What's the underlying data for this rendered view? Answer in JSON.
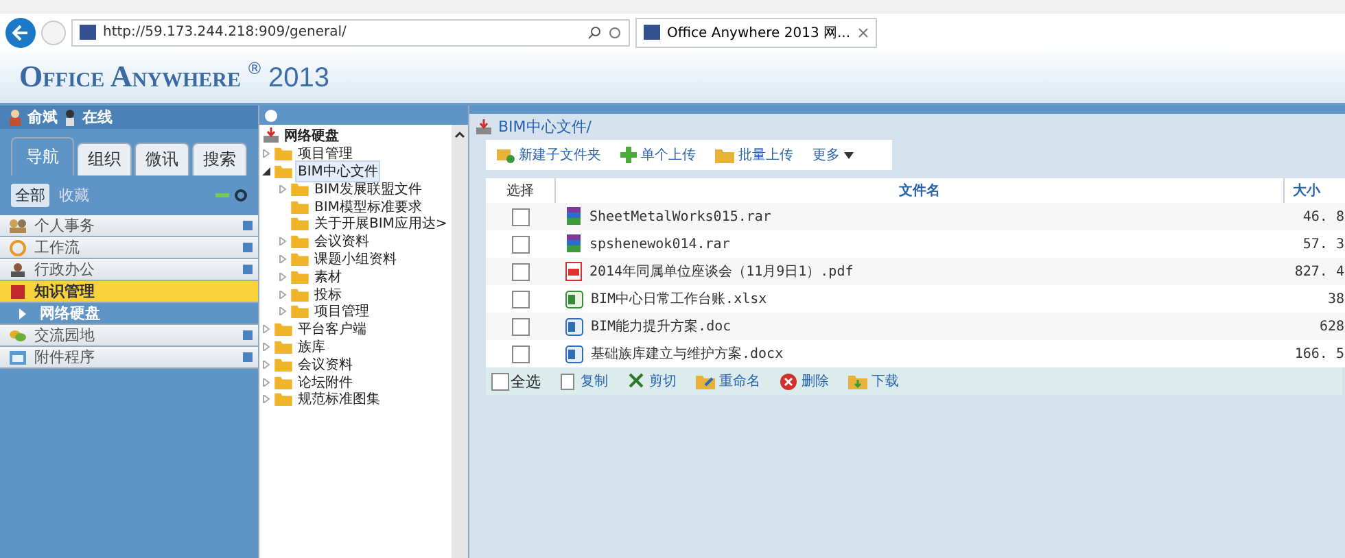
{
  "browser": {
    "url": "http://59.173.244.218:909/general/",
    "tab_title": "Office Anywhere 2013 网..."
  },
  "header": {
    "brand": "Office Anywhere",
    "superscript": "®",
    "year": "2013"
  },
  "user": {
    "name": "俞斌",
    "status": "在线"
  },
  "left_tabs": [
    {
      "label": "导航",
      "selected": true
    },
    {
      "label": "组织",
      "selected": false
    },
    {
      "label": "微讯",
      "selected": false
    },
    {
      "label": "搜索",
      "selected": false
    }
  ],
  "filter_tabs": [
    {
      "label": "全部",
      "selected": true
    },
    {
      "label": "收藏",
      "selected": false
    }
  ],
  "menu": [
    {
      "label": "个人事务",
      "kind": "group",
      "selected": false
    },
    {
      "label": "工作流",
      "kind": "group",
      "selected": false
    },
    {
      "label": "行政办公",
      "kind": "group",
      "selected": false
    },
    {
      "label": "知识管理",
      "kind": "group",
      "selected": true
    },
    {
      "label": "网络硬盘",
      "kind": "sub",
      "selected": false
    },
    {
      "label": "交流园地",
      "kind": "group",
      "selected": false
    },
    {
      "label": "附件程序",
      "kind": "group",
      "selected": false
    }
  ],
  "tree": {
    "root": "网络硬盘",
    "items": [
      {
        "label": "项目管理",
        "expanded": false
      },
      {
        "label": "BIM中心文件",
        "expanded": true,
        "selected": true,
        "children": [
          {
            "label": "BIM发展联盟文件",
            "expanded": false
          },
          {
            "label": "BIM模型标准要求"
          },
          {
            "label": "关于开展BIM应用达>"
          },
          {
            "label": "会议资料",
            "expanded": false
          },
          {
            "label": "课题小组资料",
            "expanded": false
          },
          {
            "label": "素材",
            "expanded": false
          },
          {
            "label": "投标",
            "expanded": false
          },
          {
            "label": "项目管理",
            "expanded": false
          }
        ]
      },
      {
        "label": "平台客户端",
        "expanded": false
      },
      {
        "label": "族库",
        "expanded": false
      },
      {
        "label": "会议资料",
        "expanded": false
      },
      {
        "label": "论坛附件",
        "expanded": false
      },
      {
        "label": "规范标准图集",
        "expanded": false
      }
    ]
  },
  "path": "BIM中心文件/",
  "toolbar": [
    {
      "label": "新建子文件夹",
      "kind": "button"
    },
    {
      "label": "单个上传",
      "kind": "button"
    },
    {
      "label": "批量上传",
      "kind": "button"
    },
    {
      "label": "更多",
      "kind": "dropdown"
    }
  ],
  "table": {
    "columns": [
      "选择",
      "文件名",
      "大小"
    ],
    "rows": [
      {
        "checked": false,
        "kind": "archive",
        "name": "SheetMetalWorks015.rar",
        "size": "46. 8"
      },
      {
        "checked": false,
        "kind": "archive",
        "name": "spshenewok014.rar",
        "size": "57. 3"
      },
      {
        "checked": false,
        "kind": "pdf",
        "name": "2014年同属单位座谈会（11月9日1）.pdf",
        "size": "827. 4"
      },
      {
        "checked": false,
        "kind": "sheet",
        "name": "BIM中心日常工作台账.xlsx",
        "size": "38"
      },
      {
        "checked": false,
        "kind": "word",
        "name": "BIM能力提升方案.doc",
        "size": "628"
      },
      {
        "checked": false,
        "kind": "word",
        "name": "基础族库建立与维护方案.docx",
        "size": "166. 5"
      }
    ]
  },
  "footer": {
    "select_all": {
      "label": "全选",
      "checked": false
    },
    "actions": [
      {
        "label": "复制"
      },
      {
        "label": "剪切"
      },
      {
        "label": "重命名"
      },
      {
        "label": "删除"
      },
      {
        "label": "下载"
      }
    ]
  }
}
